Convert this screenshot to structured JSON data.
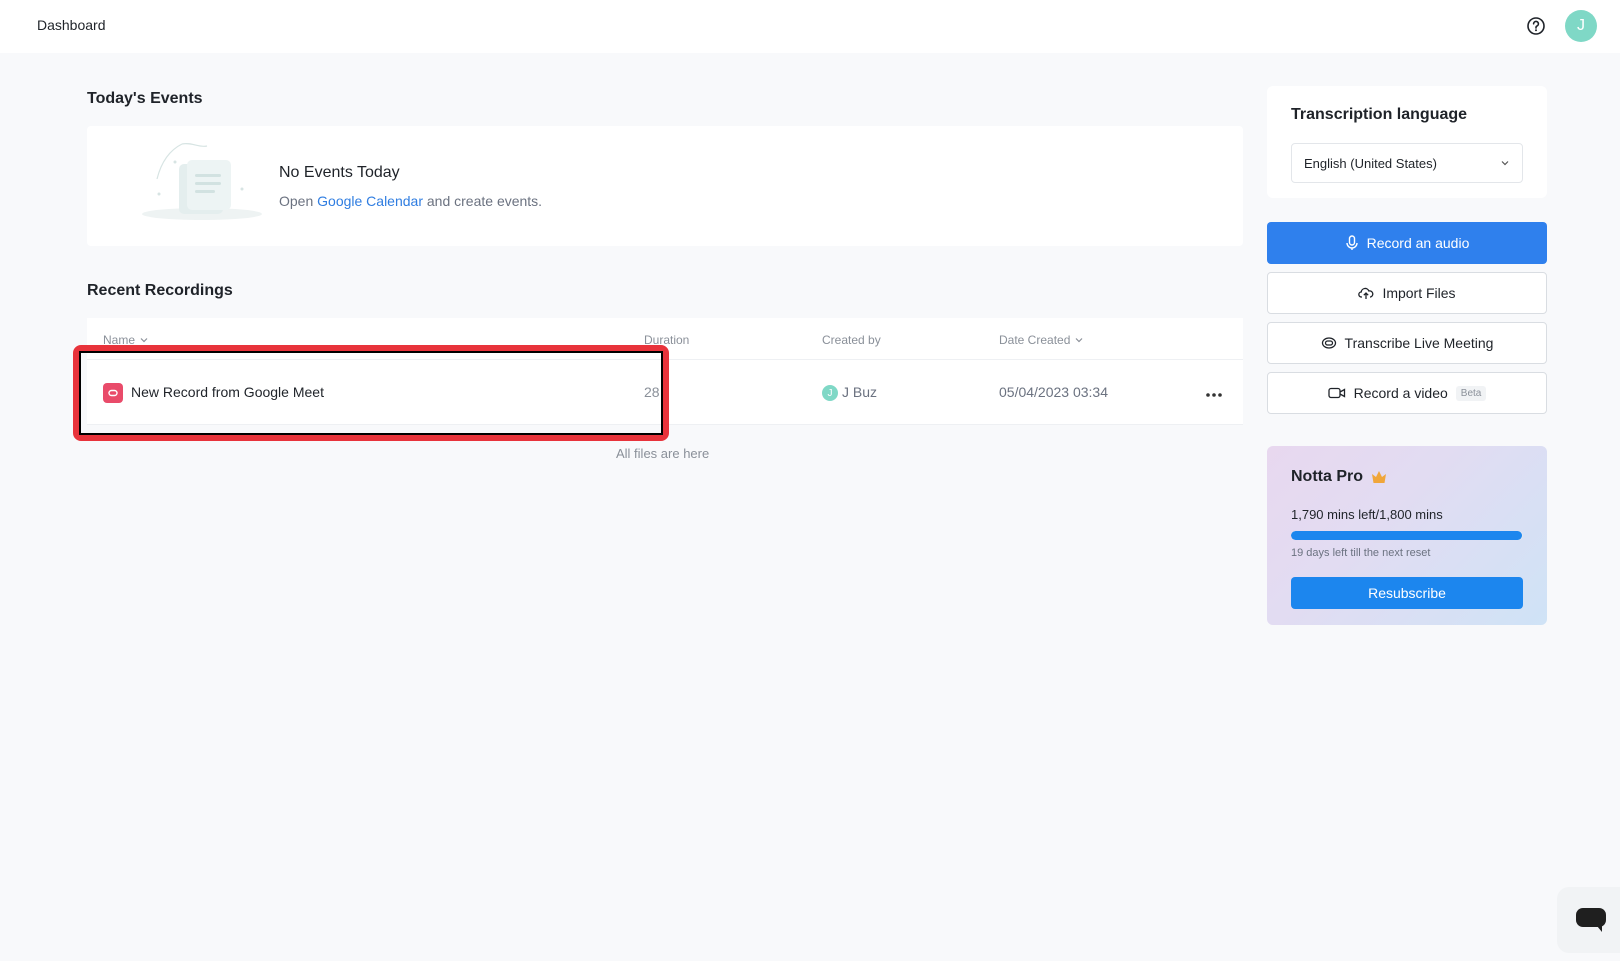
{
  "header": {
    "title": "Dashboard",
    "avatar_letter": "J"
  },
  "events": {
    "section_title": "Today's Events",
    "empty_title": "No Events Today",
    "sub_prefix": "Open",
    "sub_link": "Google Calendar",
    "sub_suffix": "and create events."
  },
  "recordings": {
    "section_title": "Recent Recordings",
    "columns": {
      "name": "Name",
      "duration": "Duration",
      "created_by": "Created by",
      "date_created": "Date Created"
    },
    "rows": [
      {
        "name": "New Record from Google Meet",
        "duration": "28",
        "creator_initial": "J",
        "creator": "J Buz",
        "date": "05/04/2023 03:34"
      }
    ],
    "footer": "All files are here"
  },
  "sidebar": {
    "language_label": "Transcription language",
    "language_value": "English (United States)",
    "actions": {
      "record_audio": "Record an audio",
      "import_files": "Import Files",
      "transcribe_live": "Transcribe Live Meeting",
      "record_video": "Record a video",
      "beta_badge": "Beta"
    },
    "plan": {
      "title": "Notta Pro",
      "minutes": "1,790 mins left/1,800 mins",
      "progress_fraction": 0.994,
      "reset_text": "19 days left till the next reset",
      "resubscribe": "Resubscribe"
    }
  },
  "colors": {
    "primary": "#2f80ed",
    "highlight": "#e8333b",
    "avatar": "#7fd8c6",
    "record_icon": "#e94b6a"
  }
}
